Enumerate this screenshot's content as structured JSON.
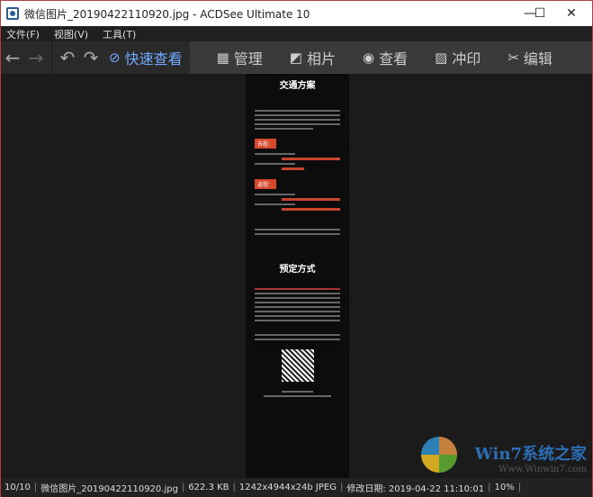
{
  "window": {
    "title": "微信图片_20190422110920.jpg - ACDSee Ultimate 10",
    "minimize": "—",
    "maximize": "☐",
    "close": "✕"
  },
  "menu": [
    "文件(F)",
    "视图(V)",
    "工具(T)"
  ],
  "toolbar": {
    "back": "←",
    "forward": "→",
    "rotate_left": "↶",
    "rotate_right": "↷"
  },
  "tabs": [
    {
      "label": "快速查看",
      "icon": "⊘"
    },
    {
      "label": "管理",
      "icon": "▦"
    },
    {
      "label": "相片",
      "icon": "◩"
    },
    {
      "label": "查看",
      "icon": "◉"
    },
    {
      "label": "冲印",
      "icon": "▨"
    },
    {
      "label": "编辑",
      "icon": "✂"
    }
  ],
  "image": {
    "heading1": "交通方案",
    "tag1": "去程：",
    "tag2": "返程：",
    "heading2": "预定方式"
  },
  "status": {
    "index": "10/10",
    "filename": "微信图片_20190422110920.jpg",
    "size": "622.3 KB",
    "dims": "1242x4944x24b JPEG",
    "modified": "修改日期: 2019-04-22 11:10:01",
    "zoom": "10%"
  },
  "watermark": {
    "logo": "Win7系统之家",
    "url": "Www.Winwin7.com"
  },
  "colors": {
    "accent": "#6fa8ff",
    "tag": "#d9472a"
  }
}
